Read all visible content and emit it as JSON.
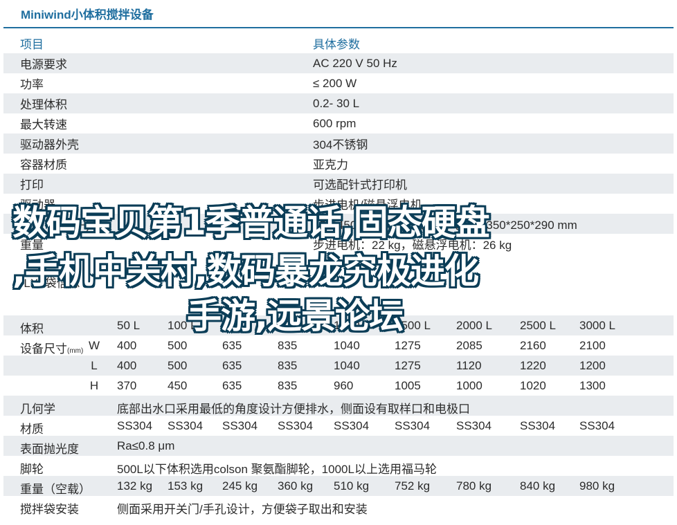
{
  "title": "Miniwind小体积搅拌设备",
  "spec_table": {
    "header": {
      "col1": "项目",
      "col2": "具体参数"
    },
    "rows": [
      {
        "item": "电源要求",
        "value": "AC 220 V 50 Hz"
      },
      {
        "item": "功率",
        "value": "≤ 200 W"
      },
      {
        "item": "处理体积",
        "value": "0.2- 30 L"
      },
      {
        "item": "最大转速",
        "value": "600 rpm"
      },
      {
        "item": "驱动器外壳",
        "value": "304不锈钢"
      },
      {
        "item": "容器材质",
        "value": "亚克力"
      },
      {
        "item": "打印",
        "value": "可选配针式打印机"
      },
      {
        "item": "驱动器",
        "value": "步进电机/磁悬浮电机"
      },
      {
        "item": "尺寸 (W*L*H)",
        "value": "450*450*280 mm，磁悬浮电机：350*250*290 mm"
      },
      {
        "item": "重量",
        "value": "步进电机：22 kg，磁悬浮电机：26 kg"
      }
    ]
  },
  "subtitle2": "FLXL袋信息",
  "bag_table": {
    "volume_label": "体积",
    "volumes": [
      "50 L",
      "100 L",
      "200 L",
      "500 L",
      "1000 L",
      "1500 L",
      "2000 L",
      "2500 L",
      "3000 L"
    ],
    "size_label": "设备尺寸",
    "size_unit": "(mm)",
    "dims": [
      {
        "dim": "W",
        "values": [
          "400",
          "500",
          "635",
          "835",
          "1040",
          "1275",
          "2085",
          "2160",
          "2100"
        ]
      },
      {
        "dim": "L",
        "values": [
          "400",
          "500",
          "635",
          "835",
          "1040",
          "1275",
          "1120",
          "1220",
          "1200"
        ]
      },
      {
        "dim": "H",
        "values": [
          "370",
          "450",
          "635",
          "835",
          "960",
          "1005",
          "1000",
          "1020",
          "1300"
        ]
      }
    ],
    "geometry_label": "几何学",
    "geometry_value": "底部出水口采用最低的角度设计方便排水，侧面设有取样口和电极口",
    "material_label": "材质",
    "materials": [
      "SS304",
      "SS304",
      "SS304",
      "SS304",
      "SS304",
      "SS304",
      "SS304",
      "SS304",
      "SS304"
    ],
    "polish_label": "表面抛光度",
    "polish_value": "Ra≤0.8 μm",
    "caster_label": "脚轮",
    "caster_value": "500L以下体积选用colson 聚氨酯脚轮，1000L以上选用福马轮",
    "weight_label": "重量（空载）",
    "weights": [
      "132 kg",
      "153 kg",
      "245 kg",
      "360 kg",
      "510 kg",
      "752 kg",
      "780 kg",
      "840 kg",
      "980 kg"
    ],
    "install_label": "搅拌袋安装",
    "install_value": "侧面采用开关门/手孔设计，方便袋子取出和安装"
  },
  "overlay": {
    "line1": "数码宝贝第1季普通话,固态硬盘",
    "line2": ",手机中关村,数码暴龙究极进化",
    "line3": "手游,远景论坛"
  }
}
